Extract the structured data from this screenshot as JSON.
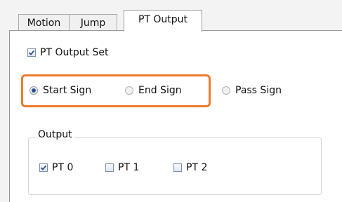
{
  "tabs": [
    {
      "label": "Motion",
      "active": false
    },
    {
      "label": "Jump",
      "active": false
    },
    {
      "label": "PT Output",
      "active": true
    }
  ],
  "pt_output_set": {
    "label": "PT Output Set",
    "checked": true
  },
  "signal_mode": {
    "options": [
      {
        "label": "Start Sign",
        "selected": true
      },
      {
        "label": "End Sign",
        "selected": false
      },
      {
        "label": "Pass Sign",
        "selected": false
      }
    ],
    "highlight_color": "#ee7b2b"
  },
  "output_group": {
    "title": "Output",
    "items": [
      {
        "label": "PT 0",
        "checked": true
      },
      {
        "label": "PT 1",
        "checked": false
      },
      {
        "label": "PT 2",
        "checked": false
      }
    ]
  }
}
